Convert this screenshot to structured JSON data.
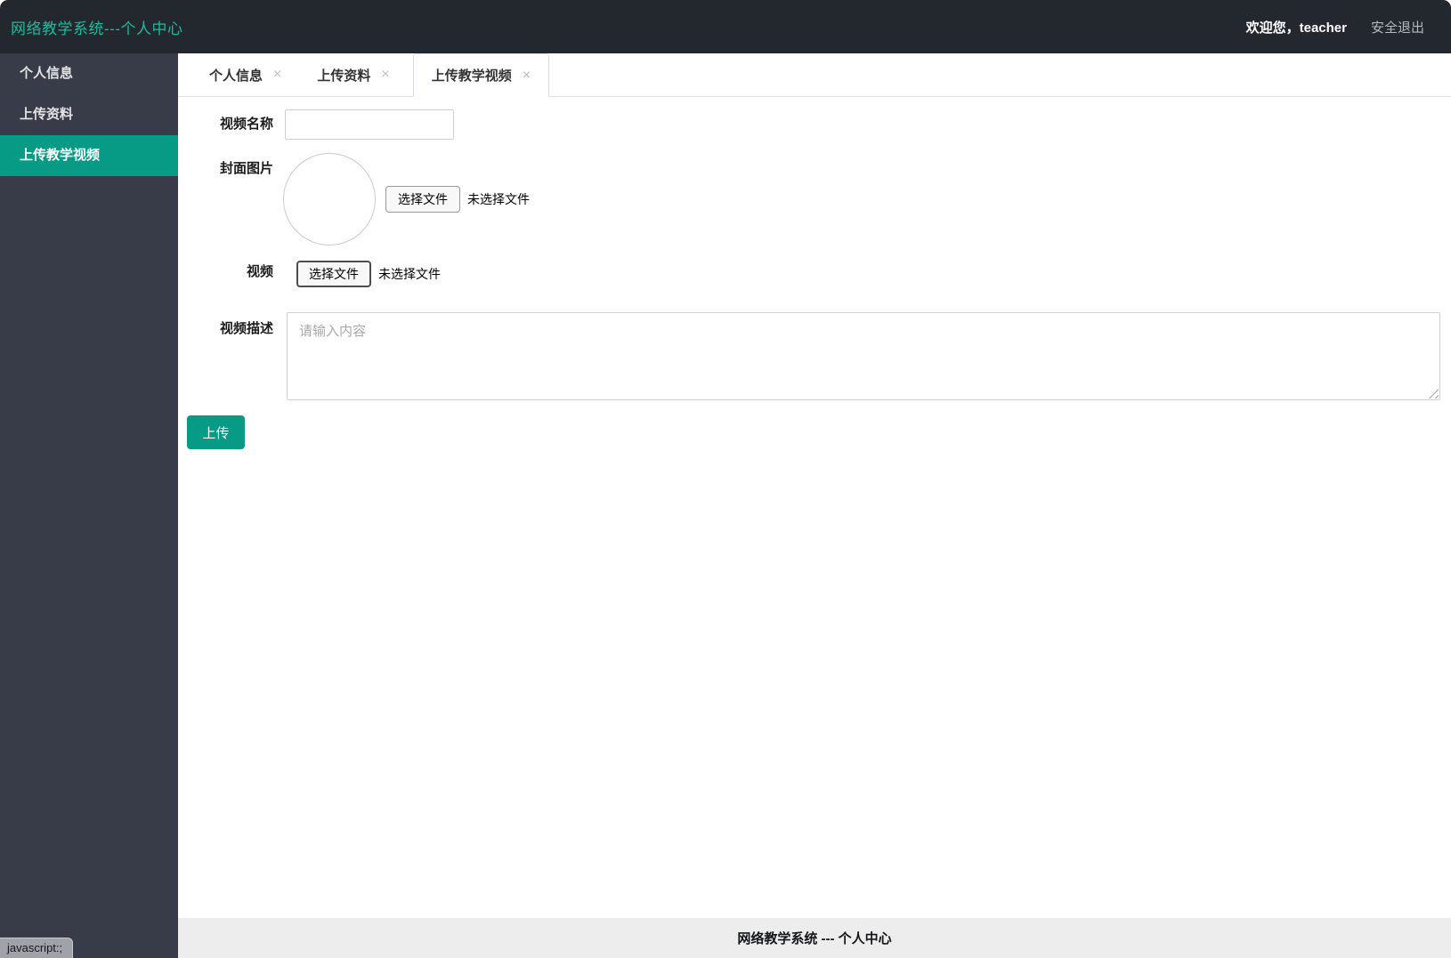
{
  "header": {
    "title": "网络教学系统---个人中心",
    "welcome": "欢迎您，teacher",
    "logout": "安全退出"
  },
  "sidebar": {
    "items": [
      {
        "label": "个人信息",
        "active": false
      },
      {
        "label": "上传资料",
        "active": false
      },
      {
        "label": "上传教学视频",
        "active": true
      }
    ]
  },
  "tabs": [
    {
      "label": "个人信息",
      "close_glyph": "×",
      "active": false
    },
    {
      "label": "上传资料",
      "close_glyph": "×",
      "active": false
    },
    {
      "label": "上传教学视频",
      "close_glyph": "×",
      "active": true
    }
  ],
  "form": {
    "video_name_label": "视频名称",
    "video_name_value": "",
    "cover_label": "封面图片",
    "video_label": "视频",
    "desc_label": "视频描述",
    "file_button_label": "选择文件",
    "no_file_text": "未选择文件",
    "desc_placeholder": "请输入内容",
    "upload_button": "上传"
  },
  "footer": {
    "text": "网络教学系统 --- 个人中心"
  },
  "status_bar": {
    "text": "javascript:;"
  },
  "colors": {
    "title_accent": "#1abc9c",
    "active_teal": "#079b85",
    "header_bg": "#23272e",
    "sidebar_bg": "#373c48",
    "footer_bg": "#ededee"
  }
}
